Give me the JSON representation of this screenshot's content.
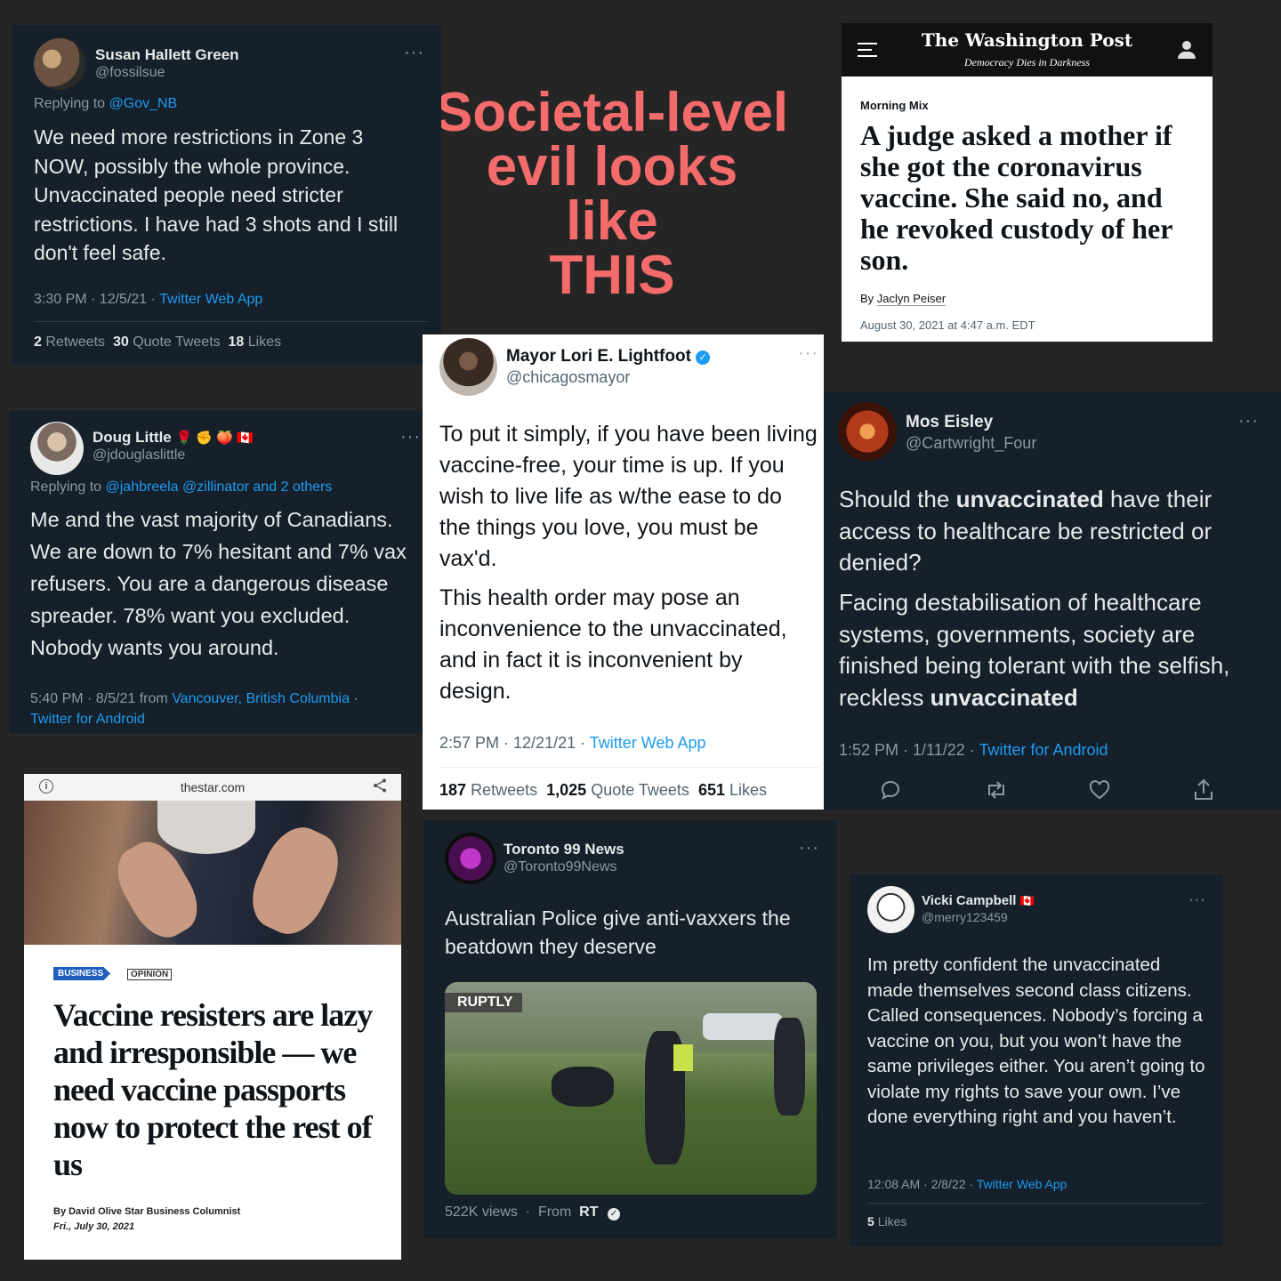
{
  "headline": {
    "line1": "Societal-level",
    "line2": "evil looks like",
    "line3": "THIS"
  },
  "tweet_susan": {
    "name": "Susan Hallett Green",
    "handle": "@fossilsue",
    "replying_prefix": "Replying to",
    "replying_to": "@Gov_NB",
    "text": "We need more restrictions in Zone 3 NOW, possibly the whole province. Unvaccinated people need stricter restrictions. I have had 3 shots and I still don't feel safe.",
    "meta": "3:30 PM · 12/5/21 ·",
    "source": "Twitter Web App",
    "retweets": "2",
    "retweets_label": "Retweets",
    "quotes": "30",
    "quotes_label": "Quote Tweets",
    "likes": "18",
    "likes_label": "Likes",
    "more": "···"
  },
  "wapo": {
    "logo": "The Washington Post",
    "tagline": "Democracy Dies in Darkness",
    "section": "Morning Mix",
    "title": "A judge asked a mother if she got the coronavirus vaccine. She said no, and he revoked custody of her son.",
    "by": "By",
    "author": "Jaclyn Peiser",
    "date": "August 30, 2021 at 4:47 a.m. EDT"
  },
  "tweet_doug": {
    "name": "Doug Little",
    "emojis": "🌹 ✊ 🍑 🇨🇦",
    "handle": "@jdouglaslittle",
    "replying_prefix": "Replying to",
    "replying_to": "@jahbreela @zillinator and 2 others",
    "text": "Me and the vast majority of Canadians. We are down to 7% hesitant and 7% vax refusers. You are a dangerous disease spreader. 78% want you excluded. Nobody wants you around.",
    "meta": "5:40 PM · 8/5/21 from",
    "location": "Vancouver, British Columbia",
    "sep": "·",
    "source": "Twitter for Android",
    "more": "···"
  },
  "tweet_lightfoot": {
    "name": "Mayor Lori E. Lightfoot",
    "handle": "@chicagosmayor",
    "para1": "To put it simply, if you have been living vaccine-free, your time is up. If you wish to live life as w/the ease to do the things you love, you must be vax'd.",
    "para2": "This health order may pose an inconvenience to the unvaccinated, and in fact it is inconvenient by design.",
    "meta": "2:57 PM · 12/21/21 ·",
    "source": "Twitter Web App",
    "retweets": "187",
    "retweets_label": "Retweets",
    "quotes": "1,025",
    "quotes_label": "Quote Tweets",
    "likes": "651",
    "likes_label": "Likes",
    "more": "···"
  },
  "tweet_mos": {
    "name": "Mos Eisley",
    "handle": "@Cartwright_Four",
    "p1_a": "Should the ",
    "p1_b": "unvaccinated",
    "p1_c": " have their access to healthcare be restricted or denied?",
    "p2_a": "Facing destabilisation of healthcare systems, governments, society are finished being tolerant with the selfish, reckless ",
    "p2_b": "unvaccinated",
    "meta": "1:52 PM · 1/11/22 ·",
    "source": "Twitter for Android",
    "more": "···"
  },
  "thestar": {
    "domain": "thestar.com",
    "tag_business": "BUSINESS",
    "tag_opinion": "OPINION",
    "title": "Vaccine resisters are lazy and irresponsible — we need vaccine passports now to protect the rest of us",
    "byline": "By David Olive Star Business Columnist",
    "date": "Fri., July 30, 2021"
  },
  "tweet_toronto": {
    "name": "Toronto 99 News",
    "handle": "@Toronto99News",
    "text": "Australian Police give anti-vaxxers the beatdown they deserve",
    "watermark": "RUPTLY",
    "views": "522K views",
    "dot": "·",
    "from": "From",
    "from_source": "RT",
    "more": "···"
  },
  "tweet_vicki": {
    "name": "Vicki Campbell",
    "flag": "🇨🇦",
    "handle": "@merry123459",
    "text": "Im pretty confident the unvaccinated made themselves second class citizens. Called consequences. Nobody’s forcing a vaccine on you, but you won’t have the same privileges either. You aren’t going to violate my rights to save your own. I’ve done everything right and you haven’t.",
    "meta": "12:08 AM · 2/8/22 ·",
    "source": "Twitter Web App",
    "likes": "5",
    "likes_label": "Likes",
    "more": "···"
  },
  "colors": {
    "background": "#252525",
    "tweet_dark": "#15202b",
    "link": "#1d9bf0",
    "headline": "#f46b6b",
    "wapo_bar": "#111111",
    "star_blue": "#1f5fbf"
  }
}
